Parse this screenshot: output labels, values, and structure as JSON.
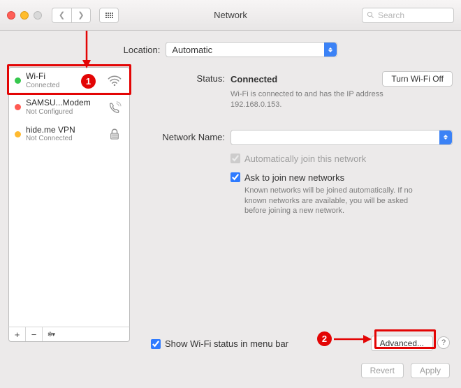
{
  "titlebar": {
    "title": "Network",
    "search_placeholder": "Search"
  },
  "location": {
    "label": "Location:",
    "value": "Automatic"
  },
  "services": [
    {
      "name": "Wi-Fi",
      "status": "Connected"
    },
    {
      "name": "SAMSU...Modem",
      "status": "Not Configured"
    },
    {
      "name": "hide.me VPN",
      "status": "Not Connected"
    }
  ],
  "detail": {
    "status_label": "Status:",
    "status_value": "Connected",
    "turn_off_label": "Turn Wi-Fi Off",
    "status_desc": "Wi-Fi is connected to            and has the IP address 192.168.0.153.",
    "network_name_label": "Network Name:",
    "network_name_value": " ",
    "auto_join_label": "Automatically join this network",
    "ask_join_label": "Ask to join new networks",
    "ask_join_help": "Known networks will be joined automatically. If no known networks are available, you will be asked before joining a new network."
  },
  "menubar": {
    "show_status_label": "Show Wi-Fi status in menu bar",
    "advanced_label": "Advanced..."
  },
  "actions": {
    "revert": "Revert",
    "apply": "Apply"
  },
  "footer": {
    "plus": "+",
    "minus": "−",
    "gear": "✻▾"
  },
  "annotations": {
    "badge1": "1",
    "badge2": "2"
  }
}
